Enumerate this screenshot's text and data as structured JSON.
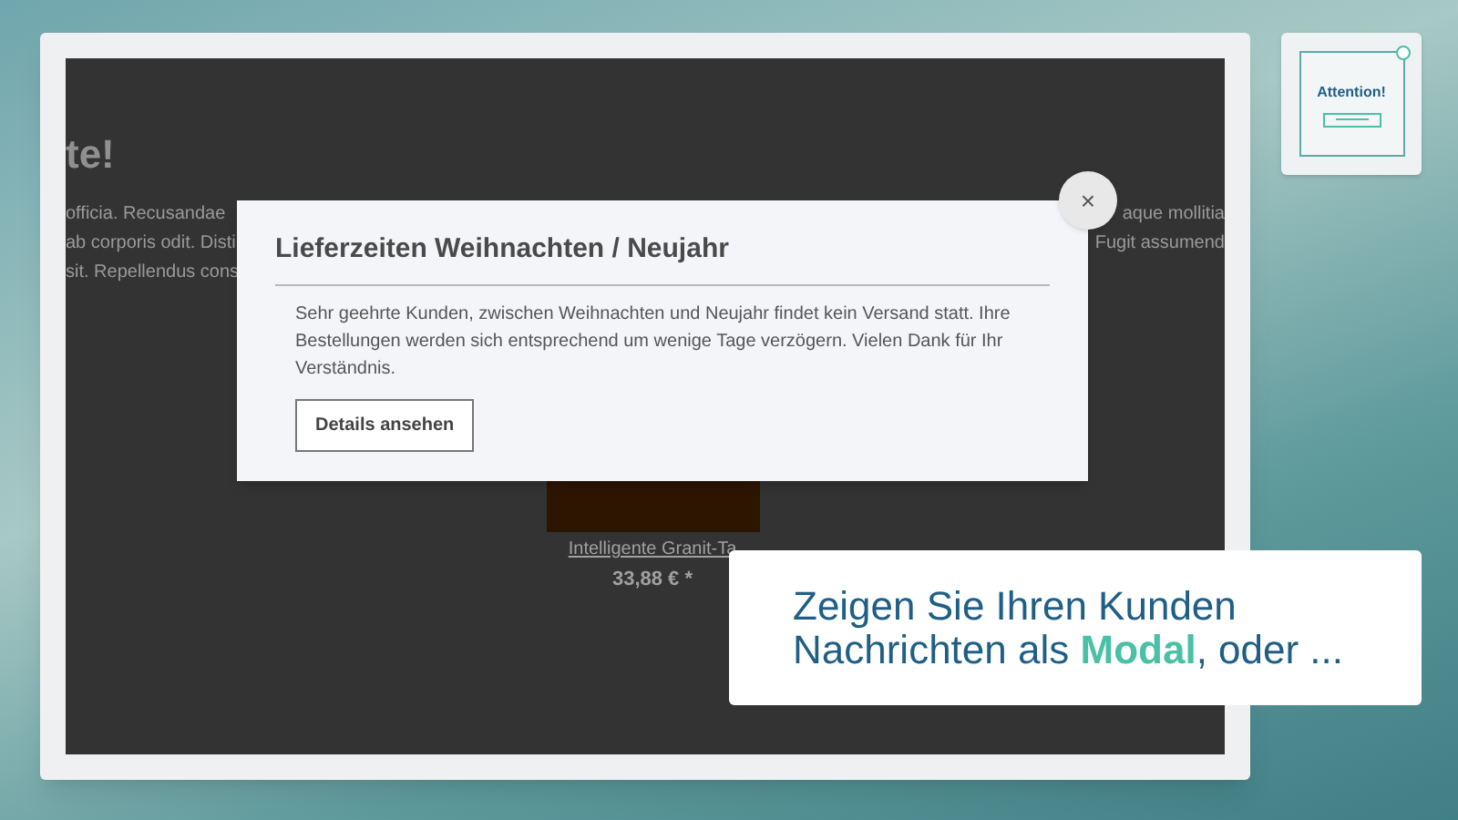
{
  "background_page": {
    "heading": "te!",
    "paragraph_lines": [
      "officia. Recusandae",
      "ab corporis odit. Disti",
      "sit. Repellendus cons"
    ],
    "right_lines": [
      "aque mollitia",
      "Fugit assumend"
    ],
    "product": {
      "name": "Intelligente Granit-Ta",
      "price": "33,88 € *"
    }
  },
  "modal": {
    "title": "Lieferzeiten Weihnachten / Neujahr",
    "close": "×",
    "body": "Sehr geehrte Kunden, zwischen Weihnachten und Neujahr findet kein Versand statt. Ihre Bestellungen werden sich entsprechend um wenige Tage verzögern. Vielen Dank für Ihr Verständnis.",
    "button": "Details ansehen"
  },
  "callout": {
    "lines": [
      [
        {
          "text": "Zeigen Sie Ihren Kunden",
          "highlighted": false
        }
      ],
      [
        {
          "text": "Nachrichten als ",
          "highlighted": false
        },
        {
          "text": "Modal",
          "highlighted": true
        },
        {
          "text": ", oder ...",
          "highlighted": false
        }
      ]
    ]
  },
  "thumbnail": {
    "label": "Attention!"
  }
}
